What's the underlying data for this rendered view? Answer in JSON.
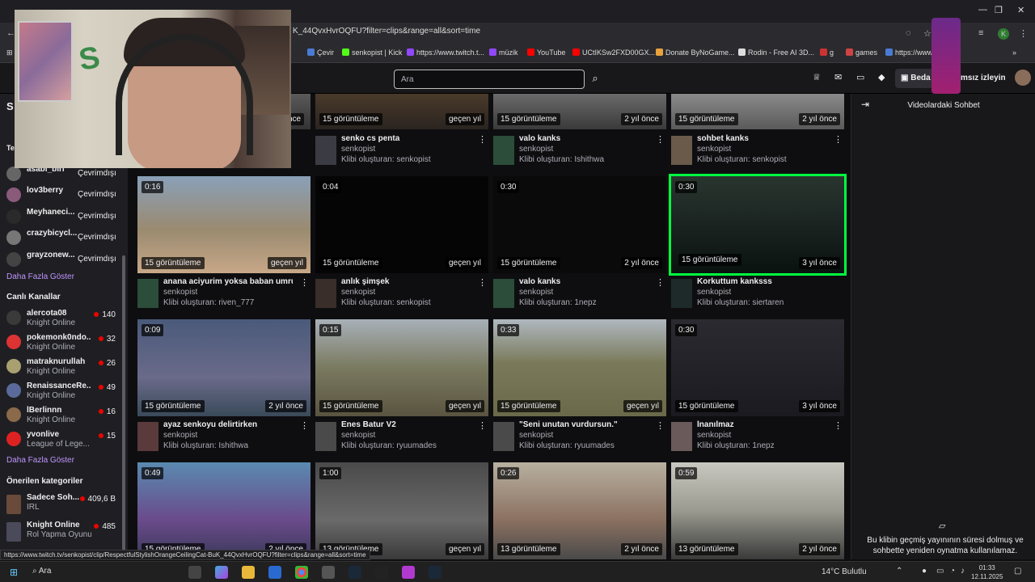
{
  "browser": {
    "url": "K_44QvxHvrOQFU?filter=clips&range=all&sort=time",
    "bookmarks": [
      "Çevir",
      "senkopist | Kick",
      "https://www.twitch.t...",
      "müzik",
      "YouTube",
      "UCtIKSw2FXD00GX...",
      "Donate ByNoGame...",
      "Rodin - Free AI 3D...",
      "g",
      "games",
      "https://www..."
    ]
  },
  "twitch": {
    "search_placeholder": "Ara",
    "prime_label": "Beda",
    "watch_label": "msız izleyin"
  },
  "sidebar": {
    "followed": [
      {
        "name": "asabi_biri",
        "status": "Çevrimdışı"
      },
      {
        "name": "lov3berry",
        "status": "Çevrimdışı"
      },
      {
        "name": "Meyhaneci...",
        "status": "Çevrimdışı"
      },
      {
        "name": "crazybicycl...",
        "status": "Çevrimdışı"
      },
      {
        "name": "grayzonew...",
        "status": "Çevrimdışı"
      }
    ],
    "more1": "Daha Fazla Göster",
    "live_title": "Canlı Kanallar",
    "live": [
      {
        "name": "alercota08",
        "game": "Knight Online",
        "viewers": "140"
      },
      {
        "name": "pokemonk0ndo...",
        "game": "Knight Online",
        "viewers": "32"
      },
      {
        "name": "matraknurullah",
        "game": "Knight Online",
        "viewers": "26"
      },
      {
        "name": "RenaissanceRe...",
        "game": "Knight Online",
        "viewers": "49"
      },
      {
        "name": "lBerlinnn",
        "game": "Knight Online",
        "viewers": "16"
      },
      {
        "name": "yvonlive",
        "game": "League of Lege...",
        "viewers": "15"
      }
    ],
    "more2": "Daha Fazla Göster",
    "cat_title": "Önerilen kategoriler",
    "categories": [
      {
        "name": "Sadece Soh...",
        "sub": "IRL",
        "viewers": "409,6 B"
      },
      {
        "name": "Knight Online",
        "sub": "Rol Yapma Oyunu",
        "viewers": "485"
      }
    ],
    "initials": [
      "S",
      "Te"
    ]
  },
  "clips_top": [
    {
      "views": "15 görüntüleme",
      "ago": "geçen yıl",
      "title": "senko cs penta",
      "channel": "senkopist",
      "by": "Klibi oluşturan: senkopist",
      "partial_ago": "nce"
    },
    {
      "views": "15 görüntüleme",
      "ago": "2 yıl önce",
      "title": "valo kanks",
      "channel": "senkopist",
      "by": "Klibi oluşturan: Ishithwa"
    },
    {
      "views": "15 görüntüleme",
      "ago": "2 yıl önce",
      "title": "sohbet kanks",
      "channel": "senkopist",
      "by": "Klibi oluşturan: senkopist"
    }
  ],
  "clips": [
    {
      "dur": "0:16",
      "views": "15 görüntüleme",
      "ago": "geçen yıl",
      "title": "anana aciyurim yoksa baban umru...",
      "channel": "senkopist",
      "by": "Klibi oluşturan: riven_777"
    },
    {
      "dur": "0:04",
      "views": "15 görüntüleme",
      "ago": "geçen yıl",
      "title": "anlık şimşek",
      "channel": "senkopist",
      "by": "Klibi oluşturan: senkopist"
    },
    {
      "dur": "0:30",
      "views": "15 görüntüleme",
      "ago": "2 yıl önce",
      "title": "valo kanks",
      "channel": "senkopist",
      "by": "Klibi oluşturan: 1nepz"
    },
    {
      "dur": "0:30",
      "views": "15 görüntüleme",
      "ago": "3 yıl önce",
      "title": "Korkuttum kanksss",
      "channel": "senkopist",
      "by": "Klibi oluşturan: siertaren"
    },
    {
      "dur": "0:09",
      "views": "15 görüntüleme",
      "ago": "2 yıl önce",
      "title": "ayaz senkoyu delirtirken",
      "channel": "senkopist",
      "by": "Klibi oluşturan: Ishithwa"
    },
    {
      "dur": "0:15",
      "views": "15 görüntüleme",
      "ago": "geçen yıl",
      "title": "Enes Batur V2",
      "channel": "senkopist",
      "by": "Klibi oluşturan: ryuumades"
    },
    {
      "dur": "0:33",
      "views": "15 görüntüleme",
      "ago": "geçen yıl",
      "title": "\"Seni unutan vurdursun.\"",
      "channel": "senkopist",
      "by": "Klibi oluşturan: ryuumades"
    },
    {
      "dur": "0:30",
      "views": "15 görüntüleme",
      "ago": "3 yıl önce",
      "title": "İnanılmaz",
      "channel": "senkopist",
      "by": "Klibi oluşturan: 1nepz"
    },
    {
      "dur": "0:49",
      "views": "15 görüntüleme",
      "ago": "2 yıl önce"
    },
    {
      "dur": "1:00",
      "views": "13 görüntüleme",
      "ago": "geçen yıl"
    },
    {
      "dur": "0:26",
      "views": "13 görüntüleme",
      "ago": "2 yıl önce"
    },
    {
      "dur": "0:59",
      "views": "13 görüntüleme",
      "ago": "2 yıl önce"
    }
  ],
  "chat": {
    "title": "Videolardaki Sohbet",
    "expired": "Bu klibin geçmiş yayınının süresi dolmuş ve sohbette yeniden oynatma kullanılamaz."
  },
  "status_url": "https://www.twitch.tv/senkopist/clip/RespectfulStylishOrangeCeilingCat-BuK_44QvxHvrOQFU?filter=clips&range=all&sort=time",
  "taskbar": {
    "search": "Ara",
    "weather": "14°C  Bulutlu",
    "time": "01:33",
    "date": "12.11.2025"
  }
}
